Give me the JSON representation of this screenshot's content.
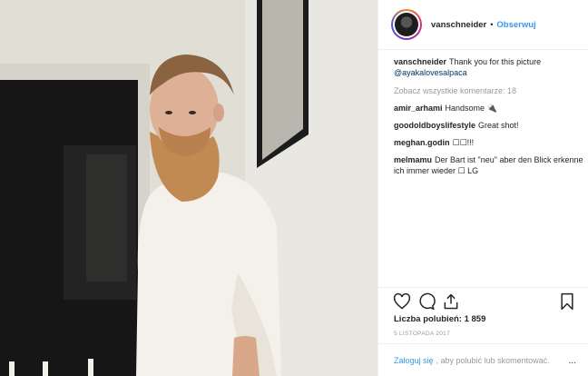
{
  "post": {
    "username": "vanschneider",
    "follow_label": "Obserwuj",
    "separator": "•",
    "caption_text": "Thank you for this picture",
    "caption_mention": "@ayakalovesalpaca",
    "view_all_comments": "Zobacz wszystkie komentarze: 18",
    "comments": [
      {
        "user": "amir_arhami",
        "text": "Handsome 🔌"
      },
      {
        "user": "goodoldboyslifestyle",
        "text": "Great shot!"
      },
      {
        "user": "meghan.godin",
        "text": "☐☐!!!"
      },
      {
        "user": "melmamu",
        "text": "Der Bart ist \"neu\" aber den Blick erkenne ich immer wieder ☐ LG"
      }
    ],
    "likes_label": "Liczba polubień: 1 859",
    "date": "5 LISTOPADA 2017",
    "login_link": "Zaloguj się",
    "login_text": ", aby polubić lub skomentować.",
    "more": "..."
  },
  "icons": [
    "heart-icon",
    "comment-icon",
    "share-icon",
    "bookmark-icon"
  ],
  "colors": {
    "accent": "#3897f0",
    "text": "#262626",
    "muted": "#999999",
    "border": "#efefef"
  }
}
